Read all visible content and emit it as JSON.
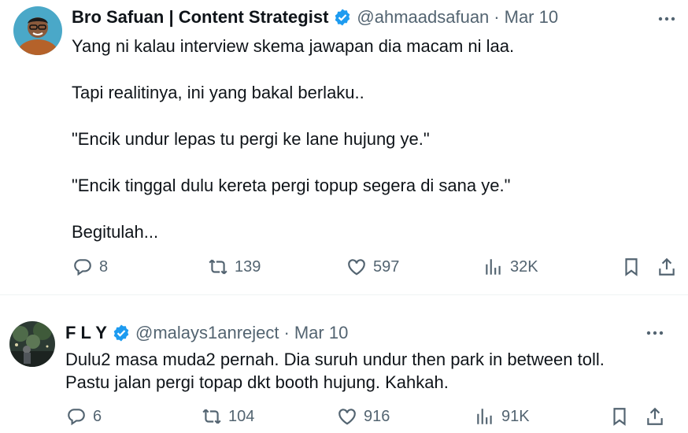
{
  "tweets": [
    {
      "author_name": "Bro Safuan | Content Strategist",
      "handle": "@ahmaadsafuan",
      "separator": "·",
      "date": "Mar 10",
      "lines": [
        "Yang ni kalau interview skema jawapan dia macam ni laa.",
        "Tapi realitinya, ini yang bakal berlaku..",
        "\"Encik undur lepas tu pergi ke lane hujung ye.\"",
        "\"Encik tinggal dulu kereta pergi topup segera di sana ye.\"",
        "Begitulah..."
      ],
      "replies": "8",
      "retweets": "139",
      "likes": "597",
      "views": "32K"
    },
    {
      "author_name": "F L Y",
      "handle": "@malays1anreject",
      "separator": "·",
      "date": "Mar 10",
      "lines": [
        "Dulu2 masa muda2 pernah. Dia suruh undur then park in between toll.",
        "Pastu jalan pergi topap dkt booth hujung. Kahkah."
      ],
      "replies": "6",
      "retweets": "104",
      "likes": "916",
      "views": "91K"
    }
  ],
  "colors": {
    "text": "#0f1419",
    "secondary": "#536471",
    "verified": "#1d9bf0",
    "divider": "#eff3f4"
  },
  "icons": [
    "verified-badge-icon",
    "more-icon",
    "reply-icon",
    "retweet-icon",
    "like-icon",
    "views-icon",
    "bookmark-icon",
    "share-icon"
  ]
}
